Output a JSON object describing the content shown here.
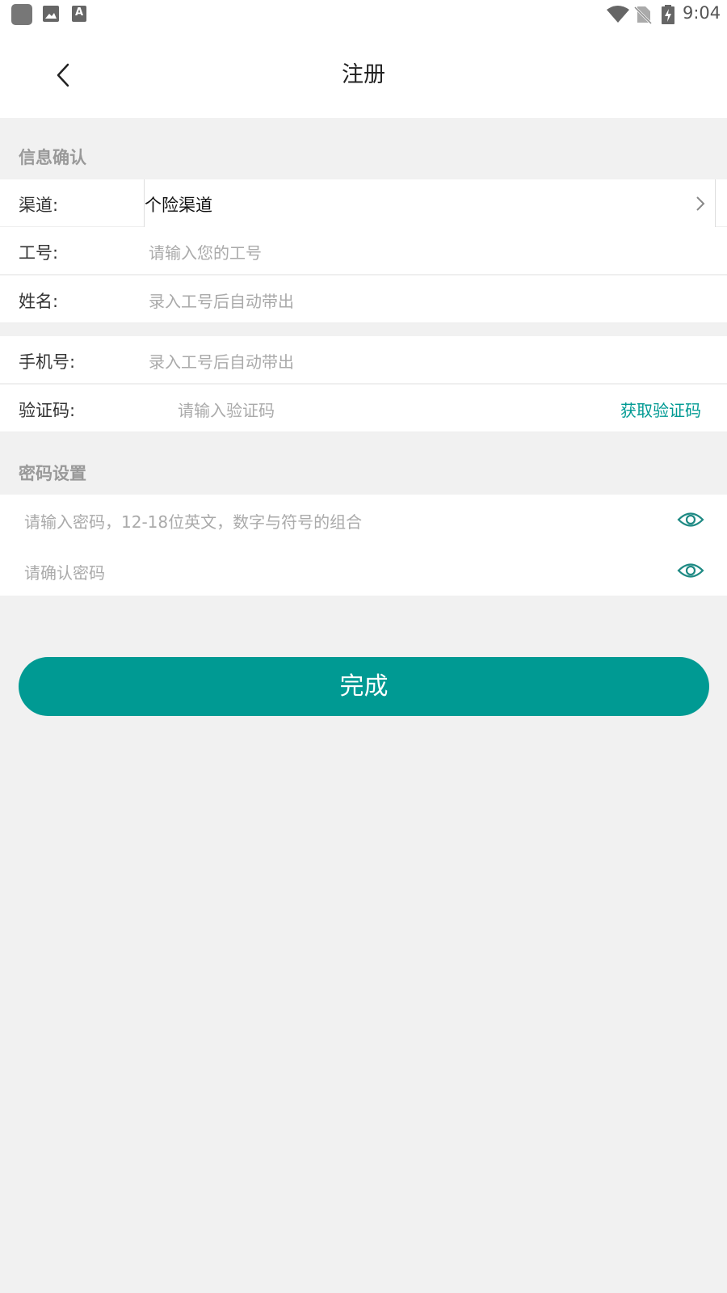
{
  "status_bar": {
    "time": "9:04",
    "notification_icons": [
      "app-icon",
      "image-icon",
      "a-icon"
    ],
    "system_icons": [
      "wifi-icon",
      "no-sim-icon",
      "battery-charging-icon"
    ],
    "a_letter": "A"
  },
  "header": {
    "title": "注册",
    "back_icon": "chevron-left-icon"
  },
  "info_section": {
    "label": "信息确认",
    "channel": {
      "label": "渠道:",
      "value": "个险渠道"
    },
    "employee_id": {
      "label": "工号:",
      "placeholder": "请输入您的工号"
    },
    "name": {
      "label": "姓名:",
      "placeholder": "录入工号后自动带出"
    }
  },
  "contact_section": {
    "phone": {
      "label": "手机号:",
      "placeholder": "录入工号后自动带出"
    },
    "code": {
      "label": "验证码:",
      "placeholder": "请输入验证码",
      "button": "获取验证码"
    }
  },
  "password_section": {
    "label": "密码设置",
    "password": {
      "placeholder": "请输入密码，12-18位英文，数字与符号的组合"
    },
    "confirm": {
      "placeholder": "请确认密码"
    }
  },
  "submit": {
    "label": "完成"
  },
  "colors": {
    "accent": "#009a93",
    "background": "#f1f1f1"
  }
}
